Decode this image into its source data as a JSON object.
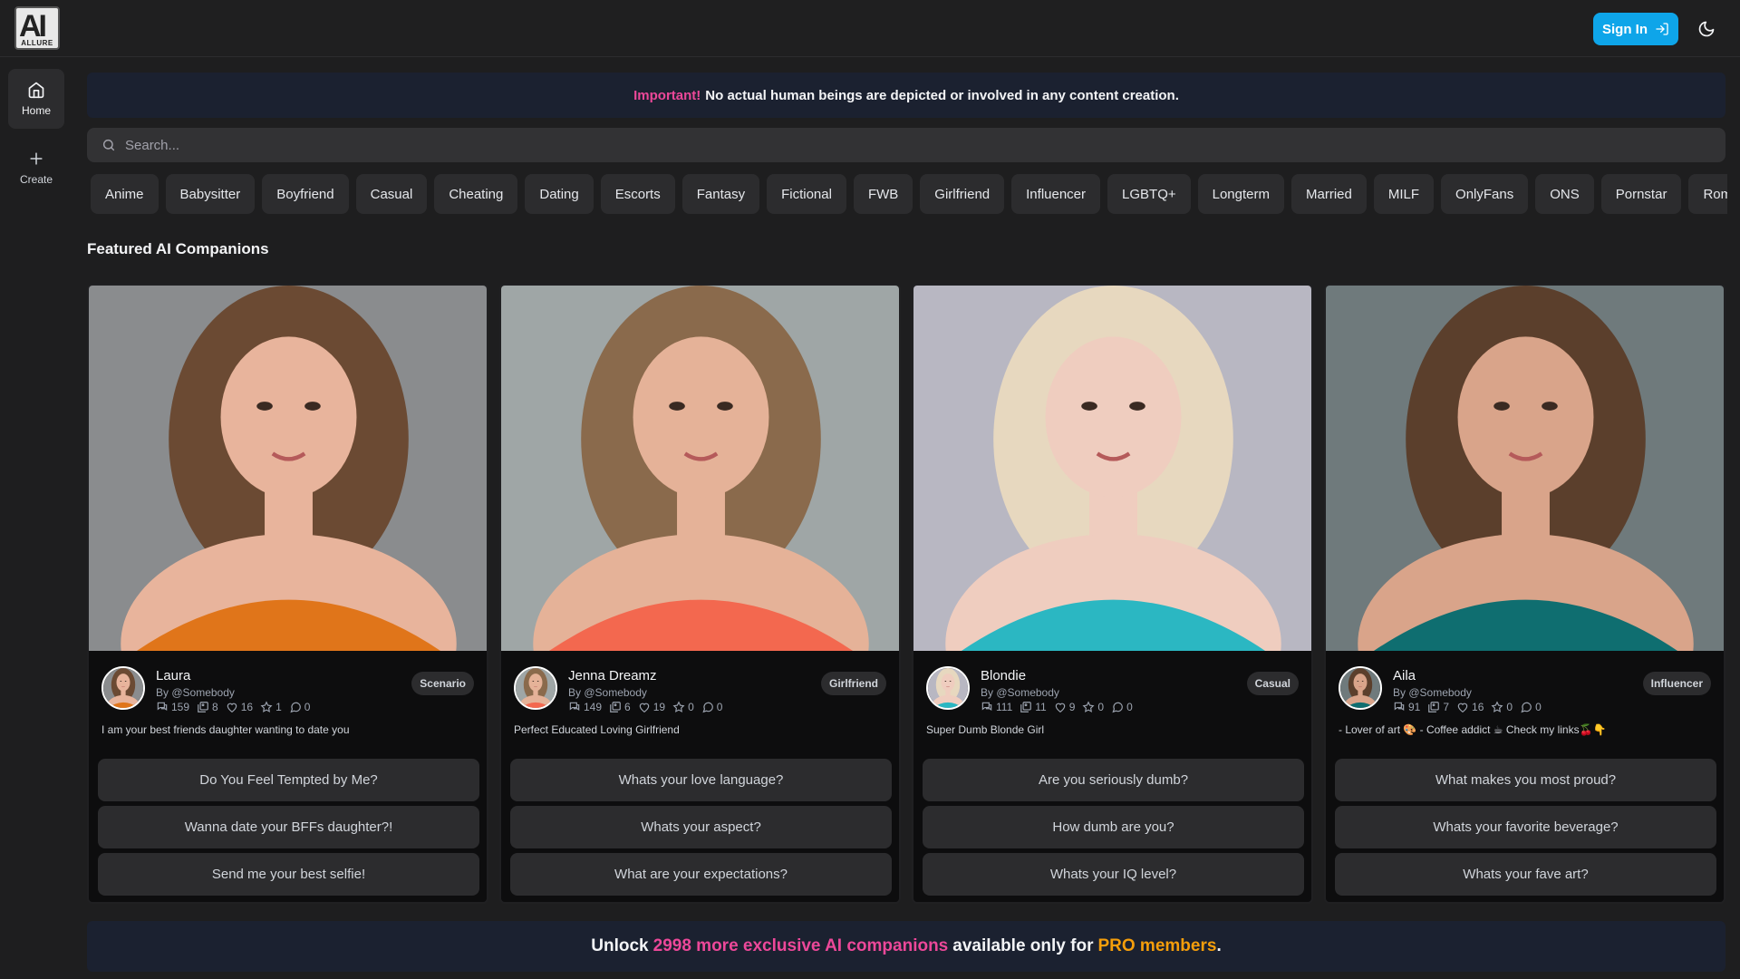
{
  "header": {
    "logo_big": "AI",
    "logo_small": "ALLURE",
    "signin_label": "Sign In"
  },
  "sidebar": {
    "items": [
      {
        "label": "Home",
        "icon": "home-icon"
      },
      {
        "label": "Create",
        "icon": "plus-icon"
      }
    ]
  },
  "notice": {
    "important": "Important!",
    "text": "No actual human beings are depicted or involved in any content creation."
  },
  "search": {
    "placeholder": "Search..."
  },
  "tags": [
    "Anime",
    "Babysitter",
    "Boyfriend",
    "Casual",
    "Cheating",
    "Dating",
    "Escorts",
    "Fantasy",
    "Fictional",
    "FWB",
    "Girlfriend",
    "Influencer",
    "LGBTQ+",
    "Longterm",
    "Married",
    "MILF",
    "OnlyFans",
    "ONS",
    "Pornstar",
    "Romance"
  ],
  "section_title": "Featured AI Companions",
  "cards": [
    {
      "name": "Laura",
      "by": "By @Somebody",
      "badge": "Scenario",
      "stats": {
        "chats": "159",
        "images": "8",
        "likes": "16",
        "stars": "1",
        "comments": "0"
      },
      "desc": "I am your best friends daughter wanting to date you",
      "prompts": [
        "Do You Feel Tempted by Me?",
        "Wanna date your BFFs daughter?!",
        "Send me your best selfie!"
      ],
      "colors": {
        "bg": "#8a8c8e",
        "hair": "#6b4a33",
        "skin": "#e8b49c",
        "outfit": "#e0751a"
      }
    },
    {
      "name": "Jenna Dreamz",
      "by": "By @Somebody",
      "badge": "Girlfriend",
      "stats": {
        "chats": "149",
        "images": "6",
        "likes": "19",
        "stars": "0",
        "comments": "0"
      },
      "desc": "Perfect Educated Loving Girlfriend",
      "prompts": [
        "Whats your love language?",
        "Whats your aspect?",
        "What are your expectations?"
      ],
      "colors": {
        "bg": "#9fa6a6",
        "hair": "#8a6a4c",
        "skin": "#e5b298",
        "outfit": "#f3684f"
      }
    },
    {
      "name": "Blondie",
      "by": "By @Somebody",
      "badge": "Casual",
      "stats": {
        "chats": "111",
        "images": "11",
        "likes": "9",
        "stars": "0",
        "comments": "0"
      },
      "desc": "Super Dumb Blonde Girl",
      "prompts": [
        "Are you seriously dumb?",
        "How dumb are you?",
        "Whats your IQ level?"
      ],
      "colors": {
        "bg": "#b8b7c2",
        "hair": "#e7d8bf",
        "skin": "#efcdbf",
        "outfit": "#2bb7c2"
      }
    },
    {
      "name": "Aila",
      "by": "By @Somebody",
      "badge": "Influencer",
      "stats": {
        "chats": "91",
        "images": "7",
        "likes": "16",
        "stars": "0",
        "comments": "0"
      },
      "desc": "- Lover of art 🎨 - Coffee addict ☕ Check my links🍒👇",
      "prompts": [
        "What makes you most proud?",
        "Whats your favorite beverage?",
        "Whats your fave art?"
      ],
      "colors": {
        "bg": "#6f7a7c",
        "hair": "#5b3f2c",
        "skin": "#d9a48a",
        "outfit": "#0f6e70"
      }
    }
  ],
  "unlock": {
    "prefix": "Unlock",
    "highlight": "2998 more exclusive AI companions",
    "middle": "available only for",
    "pro": "PRO members",
    "suffix": "."
  }
}
